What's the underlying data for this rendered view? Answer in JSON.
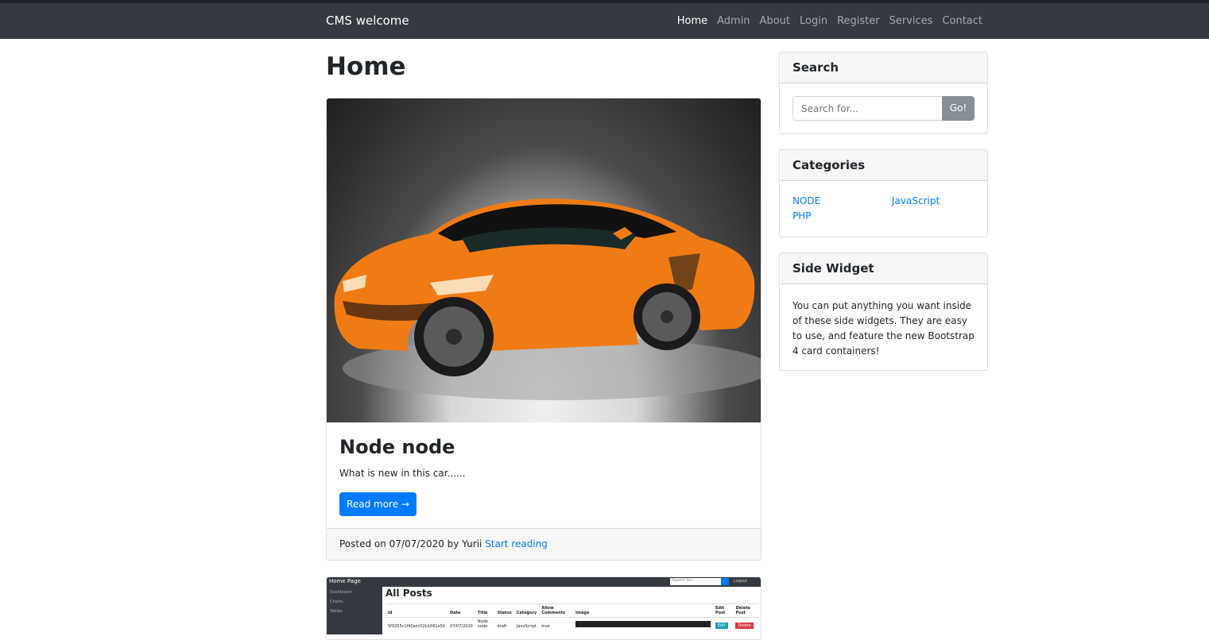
{
  "navbar": {
    "brand": "CMS welcome",
    "links": [
      "Home",
      "Admin",
      "About",
      "Login",
      "Register",
      "Services",
      "Contact"
    ],
    "active": "Home"
  },
  "main": {
    "title": "Home",
    "posts": [
      {
        "title": "Node node",
        "excerpt": "What is new in this car......",
        "read_more": "Read more →",
        "footer_prefix": "Posted on 07/07/2020 by Yurii",
        "footer_link": "Start reading"
      }
    ],
    "preview_post": {
      "app_title": "Home Page",
      "search_placeholder": "Search for...",
      "logout": "Logout",
      "sidebar": [
        "Dashboard",
        "Charts",
        "Tables"
      ],
      "heading": "All Posts",
      "columns": [
        "Id",
        "Date",
        "Title",
        "Status",
        "Category",
        "Allow Comments",
        "Image",
        "Edit Post",
        "Delete Post"
      ],
      "row": [
        "5f0255c1f40ecc02b1681e5b",
        "07/07/2020",
        "Node node",
        "draft",
        "JavaScript",
        "true",
        "",
        "Edit",
        "Delete"
      ]
    }
  },
  "sidebar": {
    "search": {
      "title": "Search",
      "placeholder": "Search for...",
      "button": "Go!"
    },
    "categories": {
      "title": "Categories",
      "items": [
        "NODE",
        "JavaScript",
        "PHP"
      ]
    },
    "side_widget": {
      "title": "Side Widget",
      "text": "You can put anything you want inside of these side widgets. They are easy to use, and feature the new Bootstrap 4 card containers!"
    }
  },
  "colors": {
    "navbar": "#343a40",
    "primary": "#007bff",
    "secondary_button": "#868e96"
  }
}
